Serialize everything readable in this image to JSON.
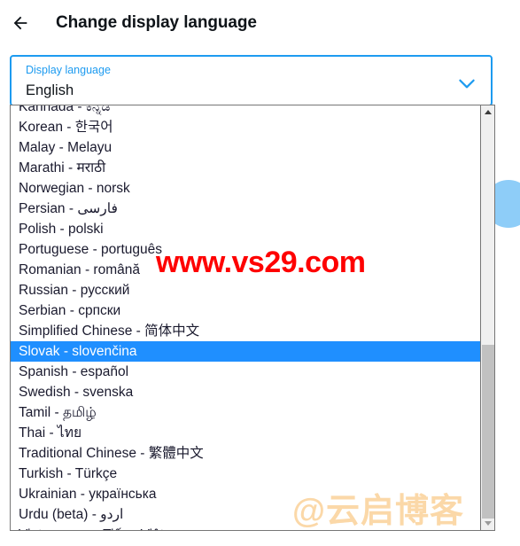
{
  "header": {
    "back_icon": "arrow-left-icon",
    "title": "Change display language"
  },
  "select": {
    "label": "Display language",
    "value": "English",
    "chevron_icon": "chevron-down-icon",
    "accent_color": "#1d9bf0"
  },
  "dropdown": {
    "highlight_color": "#1f8fff",
    "selected_index": 12,
    "options": [
      "Kannada - ಕನ್ನಡ",
      "Korean - 한국어",
      "Malay - Melayu",
      "Marathi - मराठी",
      "Norwegian - norsk",
      "Persian - فارسی",
      "Polish - polski",
      "Portuguese - português",
      "Romanian - română",
      "Russian - русский",
      "Serbian - српски",
      "Simplified Chinese - 简体中文",
      "Slovak - slovenčina",
      "Spanish - español",
      "Swedish - svenska",
      "Tamil - தமிழ்",
      "Thai - ไทย",
      "Traditional Chinese - 繁體中文",
      "Turkish - Türkçe",
      "Ukrainian - українська",
      "Urdu (beta) - اردو",
      "Vietnamese - Tiếng Việt"
    ],
    "scrollbar": {
      "up_icon": "triangle-up-icon",
      "down_icon": "triangle-down-icon"
    }
  },
  "watermarks": {
    "url": "www.vs29.com",
    "url_color": "#fe0000",
    "blog": "@云启博客",
    "blog_color": "#fbd8a8"
  }
}
